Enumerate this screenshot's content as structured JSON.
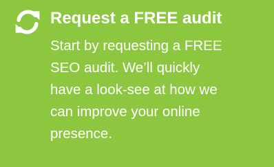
{
  "feature": {
    "icon": "refresh-icon",
    "title": "Request a FREE audit",
    "lines": [
      "Start by requesting a FREE",
      "SEO audit. We’ll quickly",
      "have a look-see at how we",
      "can improve your online",
      "presence."
    ]
  },
  "colors": {
    "background": "#8dc63f",
    "text": "#ffffff"
  }
}
